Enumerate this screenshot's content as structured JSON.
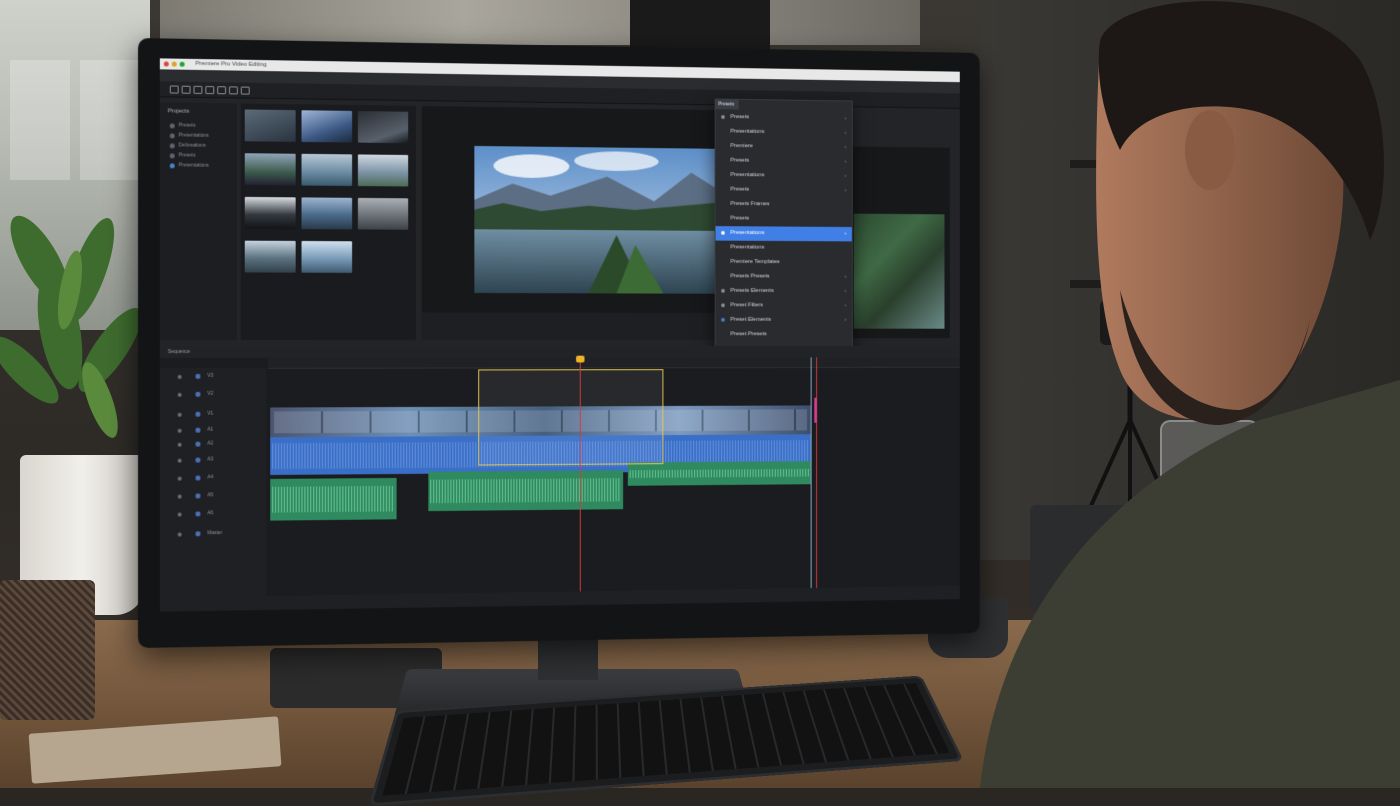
{
  "app": {
    "window_title": "Premiere Pro Video Editing"
  },
  "dropdown": {
    "header": "Presets",
    "items": [
      {
        "label": "Presets",
        "has_submenu": true,
        "selected": false
      },
      {
        "label": "Presentations",
        "has_submenu": true,
        "selected": false
      },
      {
        "label": "Premiere",
        "has_submenu": true,
        "selected": false
      },
      {
        "label": "Presets",
        "has_submenu": true,
        "selected": false
      },
      {
        "label": "Presentations",
        "has_submenu": true,
        "selected": false
      },
      {
        "label": "Presets",
        "has_submenu": true,
        "selected": false
      },
      {
        "label": "Presets Frames",
        "has_submenu": false,
        "selected": false
      },
      {
        "label": "Presets",
        "has_submenu": false,
        "selected": false
      },
      {
        "label": "Presentations",
        "has_submenu": true,
        "selected": true
      },
      {
        "label": "Presentations",
        "has_submenu": false,
        "selected": false
      },
      {
        "label": "Premiere Templates",
        "has_submenu": false,
        "selected": false
      },
      {
        "label": "Presets Presets",
        "has_submenu": true,
        "selected": false
      },
      {
        "label": "Presets Elements",
        "has_submenu": true,
        "selected": false
      },
      {
        "label": "Preset Filters",
        "has_submenu": true,
        "selected": false
      },
      {
        "label": "Preset Elements",
        "has_submenu": true,
        "selected": false
      },
      {
        "label": "Preset Presets",
        "has_submenu": false,
        "selected": false
      }
    ]
  },
  "project_panel": {
    "title": "Projects",
    "items": [
      "Presets",
      "Presentations",
      "Delineations",
      "Presets",
      "Presentations"
    ]
  },
  "timeline": {
    "title": "Sequence",
    "tracks": [
      "V3",
      "V2",
      "V1",
      "A1",
      "A2",
      "A3",
      "A4",
      "A5",
      "A6",
      "Master"
    ]
  },
  "colors": {
    "accent": "#3f7fe6",
    "playhead": "#d63b3b",
    "audio_clip": "#2f8a5f",
    "video_clip": "#3a6fc8",
    "selection": "#e5c84d"
  }
}
